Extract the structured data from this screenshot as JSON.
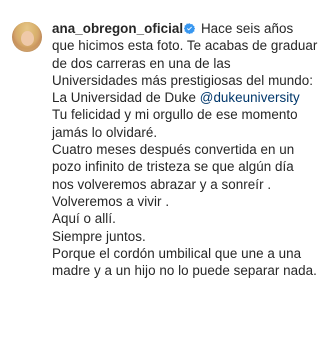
{
  "post": {
    "username": "ana_obregon_oficial",
    "verified_icon": "verified-badge-icon",
    "caption_lead": " Hace seis años que hicimos esta foto. Te acabas de graduar de dos carreras en una de las Universidades más prestigiosas del mundo: La Universidad de Duke ",
    "mention": "@dukeuniversity",
    "caption_after_mention": " Tu felicidad y mi orgullo de ese momento jamás lo olvidaré.",
    "paragraphs": [
      "Cuatro meses después convertida en un pozo infinito de tristeza se que algún día nos volveremos abrazar y a sonreír .",
      "Volveremos a vivir .",
      "Aquí o allí.",
      "Siempre juntos.",
      "Porque el cordón umbilical que une a una madre y a un hijo no lo puede separar nada."
    ],
    "colors": {
      "text": "#262626",
      "mention": "#00376b",
      "verified": "#3897f0"
    }
  }
}
